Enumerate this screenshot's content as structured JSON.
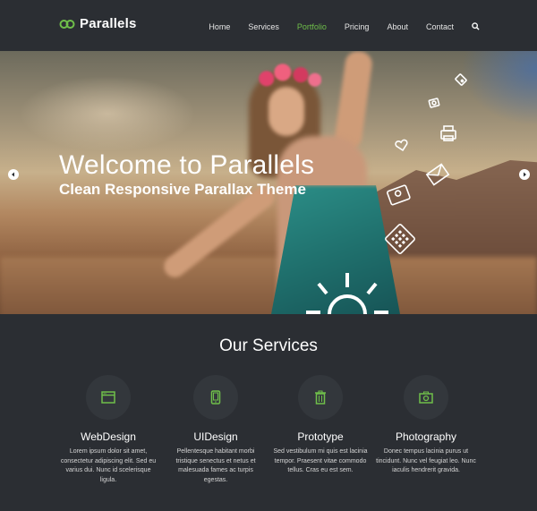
{
  "brand": {
    "name": "Parallels"
  },
  "nav": {
    "items": [
      {
        "label": "Home",
        "active": false
      },
      {
        "label": "Services",
        "active": false
      },
      {
        "label": "Portfolio",
        "active": true
      },
      {
        "label": "Pricing",
        "active": false
      },
      {
        "label": "About",
        "active": false
      },
      {
        "label": "Contact",
        "active": false
      }
    ],
    "search_icon": "search-icon"
  },
  "hero": {
    "title": "Welcome to Parallels",
    "subtitle": "Clean Responsive Parallax Theme",
    "prev_icon": "chevron-left-icon",
    "next_icon": "chevron-right-icon",
    "decorative_icons": [
      "tag-icon",
      "photo-icon",
      "heart-icon",
      "printer-icon",
      "envelope-icon",
      "map-pin-icon",
      "grid-icon",
      "sun-icon"
    ]
  },
  "services": {
    "title": "Our Services",
    "items": [
      {
        "title": "WebDesign",
        "icon": "browser-window-icon",
        "description": "Lorem ipsum dolor sit amet, consectetur adipiscing elit. Sed eu varius dui. Nunc id scelerisque ligula."
      },
      {
        "title": "UIDesign",
        "icon": "mobile-phone-icon",
        "description": "Pellentesque habitant morbi tristique senectus et netus et malesuada fames ac turpis egestas."
      },
      {
        "title": "Prototype",
        "icon": "trash-icon",
        "description": "Sed vestibulum mi quis est lacinia tempor. Praesent vitae commodo tellus. Cras eu est sem."
      },
      {
        "title": "Photography",
        "icon": "camera-icon",
        "description": "Donec tempus lacinia purus ut tincidunt. Nunc vel feugiat leo. Nunc iaculis hendrerit gravida."
      }
    ]
  },
  "colors": {
    "accent": "#6fbf4a",
    "background": "#2b2e33",
    "icon_circle": "#33373c"
  }
}
